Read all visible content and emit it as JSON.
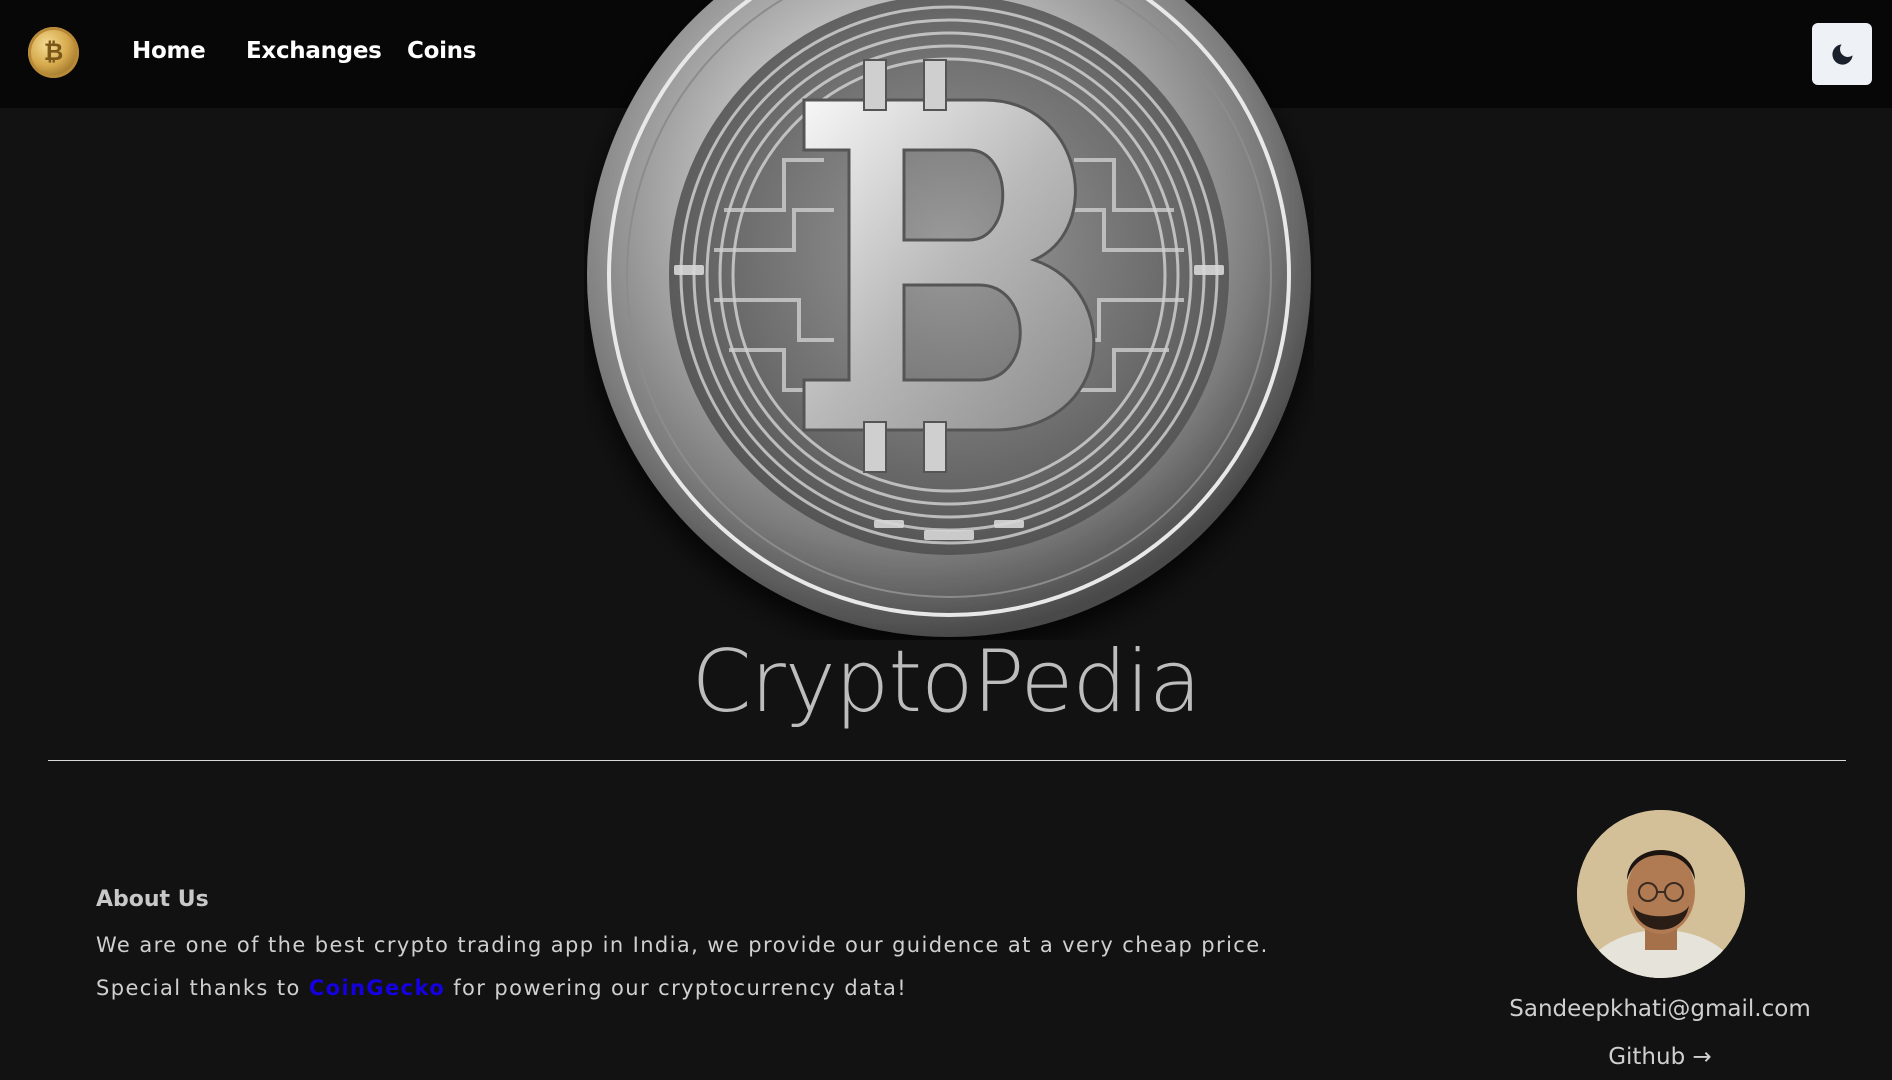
{
  "navbar": {
    "logo_icon": "bitcoin-gold-coin",
    "links": [
      {
        "label": "Home"
      },
      {
        "label": "Exchanges"
      },
      {
        "label": "Coins"
      }
    ],
    "theme_toggle_icon": "moon-icon"
  },
  "hero": {
    "image": "silver-bitcoin-coin",
    "title": "CryptoPedia"
  },
  "footer": {
    "about_heading": "About Us",
    "about_text": "We are one of the best crypto trading app in India, we provide our guidence at a very cheap price.",
    "thanks_prefix": "Special thanks to",
    "thanks_link": "CoinGecko",
    "thanks_suffix": "for powering our cryptocurrency data!",
    "email": "Sandeepkhati@gmail.com",
    "github": "Github →"
  },
  "colors": {
    "background": "#121212",
    "navbar": "#070707",
    "link_accent": "#1400e0",
    "toggle_bg": "#eef1f6"
  }
}
